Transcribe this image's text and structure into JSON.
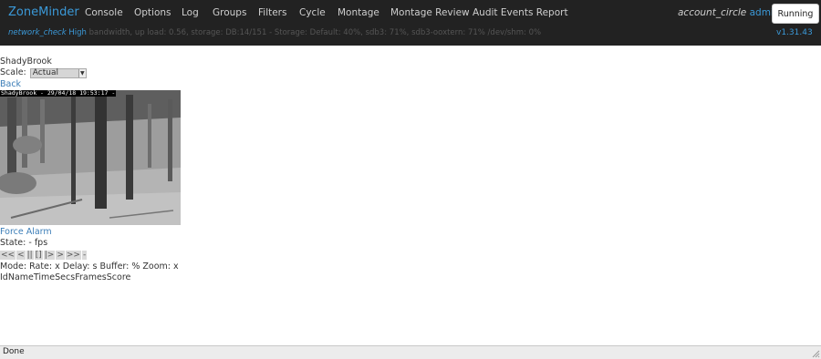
{
  "navbar": {
    "brand": "ZoneMinder",
    "items": [
      {
        "label": "Console"
      },
      {
        "label": "Options"
      },
      {
        "label": "Log"
      },
      {
        "label": "Groups"
      },
      {
        "label": "Filters"
      },
      {
        "label": "Cycle"
      },
      {
        "label": "Montage"
      },
      {
        "label": "Montage Review"
      },
      {
        "label": "Audit Events Report"
      }
    ],
    "account_icon": "account_circle",
    "user": "admin",
    "run_state": "Running"
  },
  "status": {
    "network_icon": "network_check",
    "network_level": "High",
    "info": "bandwidth, up load: 0.56, storage: DB:14/151 - Storage: Default: 40%, sdb3: 71%, sdb3-ooxtern: 71% /dev/shm: 0%",
    "version": "v1.31.43"
  },
  "monitor": {
    "title": "ShadyBrook",
    "scale_label": "Scale:",
    "scale_value": "Actual",
    "back_label": "Back",
    "osd_text": "ShadyBrook - 29/04/18 19:53:17 -",
    "force_alarm_label": "Force Alarm",
    "state_text": "State:  -  fps",
    "controls": [
      "<<",
      "<",
      "||",
      "[]",
      "|>",
      ">",
      ">>",
      "-"
    ],
    "mode_text": "Mode:  Rate:  x Delay:  s Buffer:  % Zoom:  x",
    "events_columns": [
      "Id",
      "Name",
      "Time",
      "Secs",
      "Frames",
      "Score"
    ]
  },
  "statusbar": {
    "text": "Done"
  },
  "colors": {
    "navbar_bg": "#222222",
    "accent": "#3b99d8",
    "link": "#3b7db7"
  }
}
